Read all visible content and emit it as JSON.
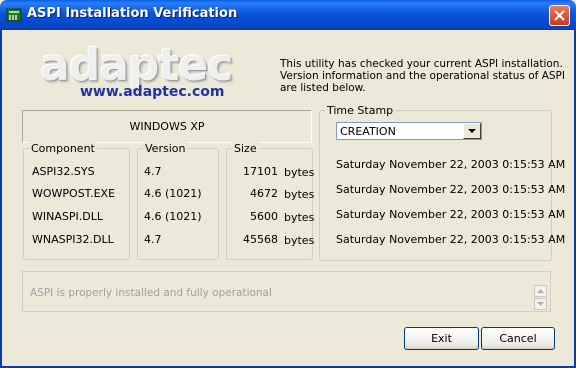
{
  "window": {
    "title": "ASPI Installation Verification",
    "title_bar_color": "#0A55DA"
  },
  "logo": {
    "brand": "adaptec",
    "url": "www.adaptec.com"
  },
  "description": "This utility has checked your current ASPI installation. Version information and the operational status of ASPI are listed below.",
  "os_label": "WINDOWS XP",
  "table": {
    "headers": {
      "component": "Component",
      "version": "Version",
      "size": "Size"
    },
    "rows": [
      {
        "component": "ASPI32.SYS",
        "version": "4.7",
        "size": "17101",
        "unit": "bytes"
      },
      {
        "component": "WOWPOST.EXE",
        "version": "4.6 (1021)",
        "size": "4672",
        "unit": "bytes"
      },
      {
        "component": "WINASPI.DLL",
        "version": "4.6 (1021)",
        "size": "5600",
        "unit": "bytes"
      },
      {
        "component": "WNASPI32.DLL",
        "version": "4.7",
        "size": "45568",
        "unit": "bytes"
      }
    ]
  },
  "timestamp": {
    "legend": "Time Stamp",
    "selected": "CREATION",
    "values": [
      "Saturday November 22, 2003 0:15:53 AM",
      "Saturday November 22, 2003 0:15:53 AM",
      "Saturday November 22, 2003 0:15:53 AM",
      "Saturday November 22, 2003 0:15:53 AM"
    ]
  },
  "status": "ASPI is properly installed and fully operational",
  "buttons": {
    "exit": "Exit",
    "cancel": "Cancel"
  }
}
